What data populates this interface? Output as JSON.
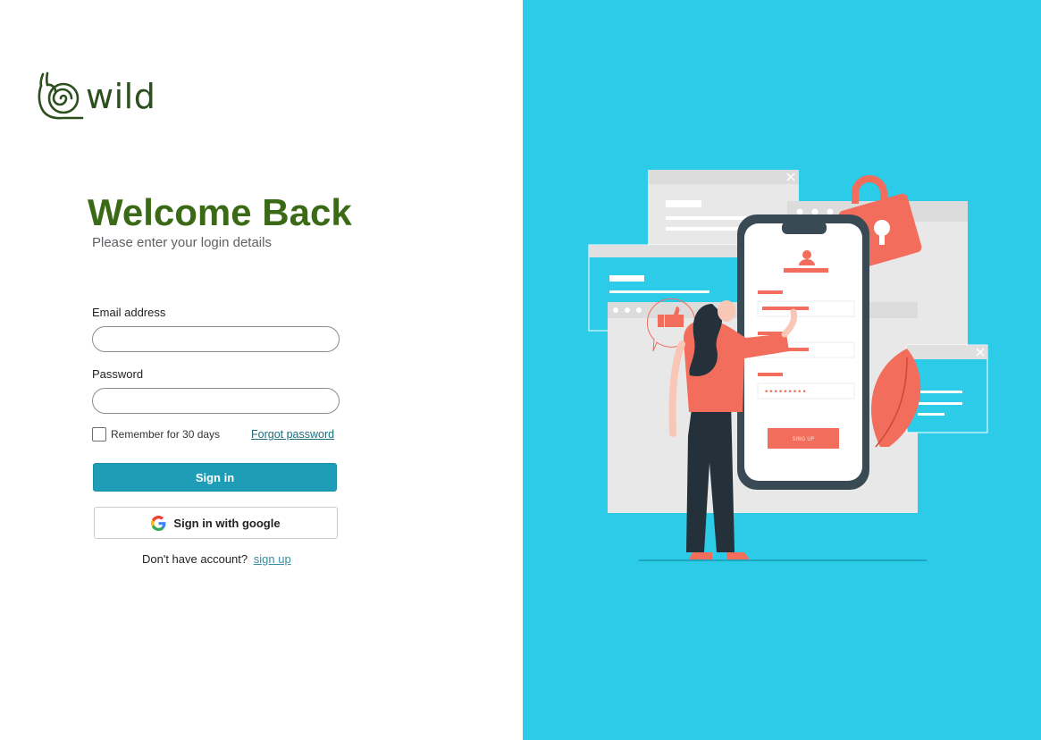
{
  "brand": {
    "name": "wild",
    "logo_icon": "snail-icon",
    "color": "#3b6a17"
  },
  "heading": {
    "title": "Welcome Back",
    "subtitle": "Please enter your login details"
  },
  "form": {
    "email_label": "Email address",
    "email_value": "",
    "password_label": "Password",
    "password_value": "",
    "remember_label": "Remember for 30 days",
    "remember_checked": false,
    "forgot_label": "Forgot password",
    "signin_label": "Sign in",
    "google_label": "Sign in with google",
    "google_icon": "google-icon",
    "no_account_text": "Don't have account?",
    "signup_label": "sign up"
  },
  "illustration": {
    "phone_button_label": "SING UP",
    "password_mask": "•••••••••"
  },
  "colors": {
    "accent": "#1f9db7",
    "panel_bg": "#2ccbe8",
    "illustration_accent": "#f26d5b"
  }
}
